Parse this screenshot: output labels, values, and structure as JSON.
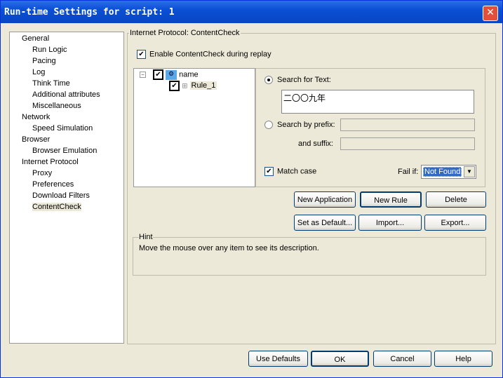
{
  "window": {
    "title": "Run-time Settings for script: 1"
  },
  "tree": [
    {
      "label": "General",
      "level": 0
    },
    {
      "label": "Run Logic",
      "level": 1
    },
    {
      "label": "Pacing",
      "level": 1
    },
    {
      "label": "Log",
      "level": 1
    },
    {
      "label": "Think Time",
      "level": 1
    },
    {
      "label": "Additional attributes",
      "level": 1
    },
    {
      "label": "Miscellaneous",
      "level": 1
    },
    {
      "label": "Network",
      "level": 0
    },
    {
      "label": "Speed Simulation",
      "level": 1
    },
    {
      "label": "Browser",
      "level": 0
    },
    {
      "label": "Browser Emulation",
      "level": 1
    },
    {
      "label": "Internet Protocol",
      "level": 0
    },
    {
      "label": "Proxy",
      "level": 1
    },
    {
      "label": "Preferences",
      "level": 1
    },
    {
      "label": "Download Filters",
      "level": 1
    },
    {
      "label": "ContentCheck",
      "level": 1,
      "selected": true
    }
  ],
  "section_title": "Internet Protocol: ContentCheck",
  "enable_label": "Enable ContentCheck during replay",
  "rules_tree": {
    "root": "name",
    "child": "Rule_1"
  },
  "search_text_label": "Search for Text:",
  "search_text_value": "二〇〇九年",
  "search_prefix_label": "Search by prefix:",
  "suffix_label": "and suffix:",
  "match_case_label": "Match case",
  "fail_if_label": "Fail if:",
  "fail_if_value": "Not Found",
  "buttons": {
    "new_app": "New Application",
    "new_rule": "New Rule",
    "delete": "Delete",
    "set_default": "Set as Default...",
    "import": "Import...",
    "export": "Export..."
  },
  "hint": {
    "title": "Hint",
    "text": "Move the mouse over any item to see its description."
  },
  "footer": {
    "use_defaults": "Use Defaults",
    "ok": "OK",
    "cancel": "Cancel",
    "help": "Help"
  }
}
